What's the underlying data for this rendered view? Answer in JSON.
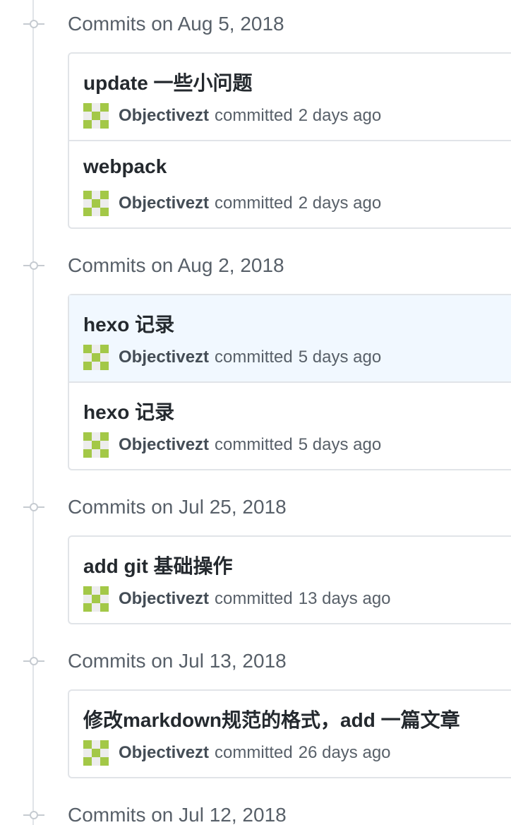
{
  "groups": [
    {
      "date_label": "Commits on Aug 5, 2018",
      "commits": [
        {
          "message": "update 一些小问题",
          "author": "Objectivezt",
          "action": "committed",
          "time": "2 days ago"
        },
        {
          "message": "webpack",
          "author": "Objectivezt",
          "action": "committed",
          "time": "2 days ago"
        }
      ]
    },
    {
      "date_label": "Commits on Aug 2, 2018",
      "commits": [
        {
          "message": "hexo 记录",
          "author": "Objectivezt",
          "action": "committed",
          "time": "5 days ago"
        },
        {
          "message": "hexo 记录",
          "author": "Objectivezt",
          "action": "committed",
          "time": "5 days ago"
        }
      ]
    },
    {
      "date_label": "Commits on Jul 25, 2018",
      "commits": [
        {
          "message": "add git 基础操作",
          "author": "Objectivezt",
          "action": "committed",
          "time": "13 days ago"
        }
      ]
    },
    {
      "date_label": "Commits on Jul 13, 2018",
      "commits": [
        {
          "message": "修改markdown规范的格式，add 一篇文章",
          "author": "Objectivezt",
          "action": "committed",
          "time": "26 days ago"
        }
      ]
    },
    {
      "date_label": "Commits on Jul 12, 2018",
      "commits": []
    }
  ],
  "colors": {
    "avatar_accent": "#a3c847",
    "highlight_row": "#f1f8ff"
  }
}
